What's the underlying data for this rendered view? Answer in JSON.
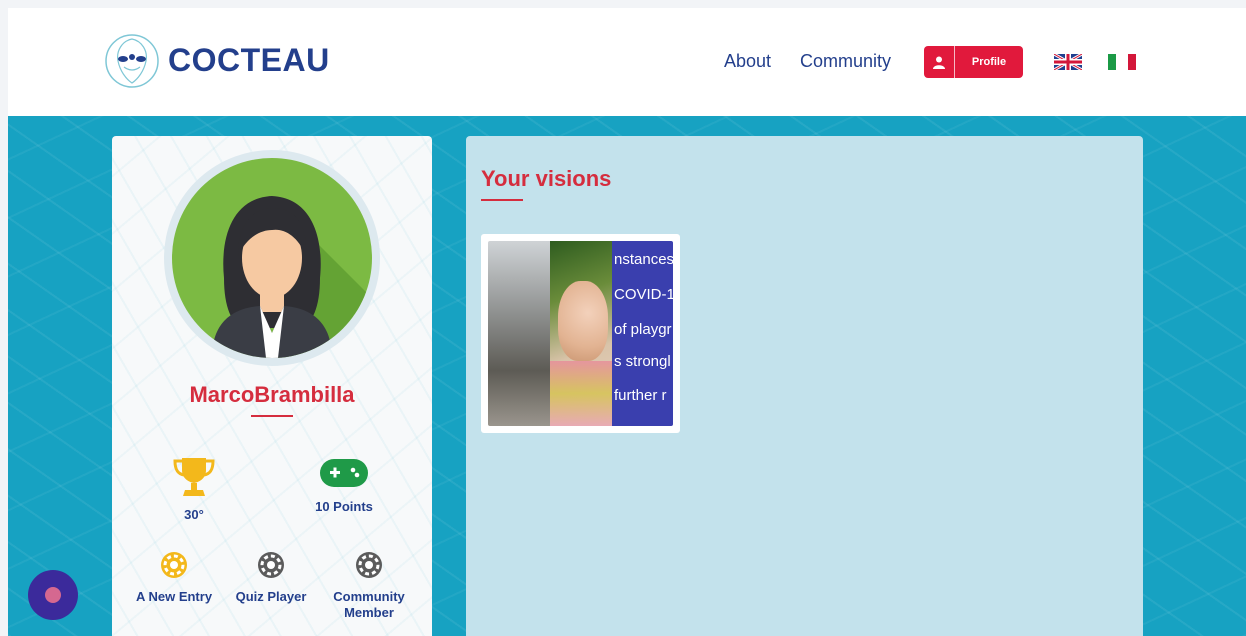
{
  "header": {
    "brand": "COCTEAU",
    "logo_icon": "cocteau-faces-logo",
    "nav": {
      "about": "About",
      "community": "Community"
    },
    "profile_button": {
      "label": "Profile",
      "icon": "user-icon",
      "color": "#e1193c"
    },
    "languages": [
      {
        "code": "en",
        "icon": "uk-flag-icon"
      },
      {
        "code": "it",
        "icon": "italy-flag-icon"
      }
    ]
  },
  "profile": {
    "username": "MarcoBrambilla",
    "avatar_icon": "avatar-woman-icon",
    "stats": [
      {
        "label": "30°",
        "icon": "trophy-icon"
      },
      {
        "label": "10 Points",
        "icon": "gamepad-icon"
      }
    ],
    "badges": [
      {
        "label": "A New Entry",
        "icon": "gear-badge-gold-icon"
      },
      {
        "label": "Quiz Player",
        "icon": "gear-badge-gray-icon"
      },
      {
        "label": "Community Member",
        "icon": "gear-badge-gray-icon"
      }
    ]
  },
  "visions": {
    "title": "Your visions",
    "items": [
      {
        "image_text_lines": [
          "nstances",
          "COVID-1",
          "of playgr",
          "s strongl",
          "further r"
        ]
      }
    ]
  },
  "colors": {
    "accent": "#d52d3e",
    "navy": "#233f8c",
    "background": "#17a2c2",
    "panel": "#c3e2ec"
  }
}
